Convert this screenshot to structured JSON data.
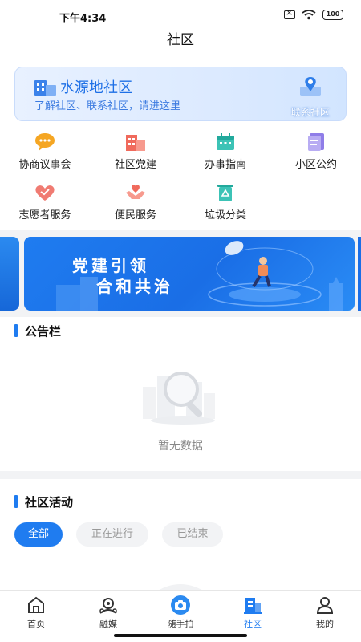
{
  "status_bar": {
    "time": "下午4:34",
    "battery": "100"
  },
  "header": {
    "title": "社区"
  },
  "community_card": {
    "name": "水源地社区",
    "subtitle": "了解社区、联系社区，请进这里",
    "contact_label": "联系社区"
  },
  "services": [
    {
      "label": "协商议事会",
      "icon": "chat-bubbles-icon"
    },
    {
      "label": "社区党建",
      "icon": "party-building-icon"
    },
    {
      "label": "办事指南",
      "icon": "calendar-guide-icon"
    },
    {
      "label": "小区公约",
      "icon": "document-book-icon"
    },
    {
      "label": "志愿者服务",
      "icon": "heart-icon"
    },
    {
      "label": "便民服务",
      "icon": "helping-hands-icon"
    },
    {
      "label": "垃圾分类",
      "icon": "recycle-bin-icon"
    }
  ],
  "banner": {
    "line1": "党建引领",
    "line2": "合和共治"
  },
  "notice": {
    "title": "公告栏",
    "empty_text": "暂无数据"
  },
  "activities": {
    "title": "社区活动",
    "filters": [
      "全部",
      "正在进行",
      "已结束"
    ],
    "selected": "全部"
  },
  "tab_bar": {
    "tabs": [
      {
        "label": "首页",
        "icon": "home-icon"
      },
      {
        "label": "融媒",
        "icon": "media-icon"
      },
      {
        "label": "随手拍",
        "icon": "camera-icon"
      },
      {
        "label": "社区",
        "icon": "community-icon"
      },
      {
        "label": "我的",
        "icon": "profile-icon"
      }
    ],
    "active": "社区"
  },
  "colors": {
    "accent": "#1f7cf0",
    "background": "#f2f3f5"
  }
}
